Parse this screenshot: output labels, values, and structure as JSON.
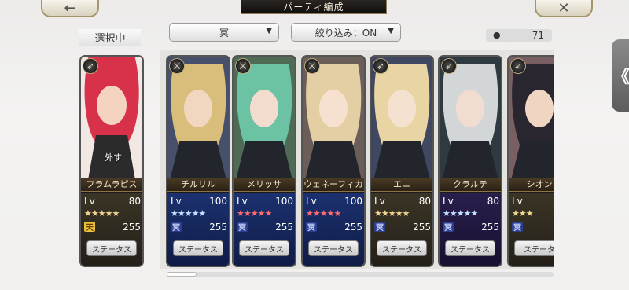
{
  "header": {
    "back_label": "←",
    "close_label": "✕",
    "title": "パーティ編成"
  },
  "selected_label": "選択中",
  "filters": {
    "sort_value": "冥",
    "filter_value": "絞り込み：ON"
  },
  "owned_count": "71",
  "side_tab_label": "《",
  "selected_card": {
    "name": "フラムラピス",
    "lv_label": "Lv",
    "level": "80",
    "stars": "★★★★★",
    "element_icon": "天",
    "element_value": "255",
    "remove_label": "外す",
    "status_label": "ステータス",
    "class_icon": "bow-icon",
    "colors": {
      "hair": "#d8324a",
      "skin": "#f4d3c0",
      "bg": "#f1e7e3"
    }
  },
  "cards": [
    {
      "name": "チルリル",
      "lv_label": "Lv",
      "level": "100",
      "stars": "★★★★★",
      "star_color": "blue",
      "element_icon": "冥",
      "element_value": "255",
      "status_label": "ステータス",
      "class_icon": "sword-icon",
      "theme": "blue",
      "colors": {
        "hair": "#d9bd7a",
        "skin": "#f2d7c0",
        "bg": "#46506a"
      }
    },
    {
      "name": "メリッサ",
      "lv_label": "Lv",
      "level": "100",
      "stars": "★★★★★",
      "star_color": "red",
      "element_icon": "冥",
      "element_value": "255",
      "status_label": "ステータス",
      "class_icon": "sword-icon",
      "theme": "blue",
      "colors": {
        "hair": "#6cc3a4",
        "skin": "#f3dccd",
        "bg": "#4f6a55"
      }
    },
    {
      "name": "ウェネーフィカ",
      "lv_label": "Lv",
      "level": "100",
      "stars": "★★★★★",
      "star_color": "red",
      "element_icon": "冥",
      "element_value": "255",
      "status_label": "ステータス",
      "class_icon": "sword-icon",
      "theme": "blue",
      "colors": {
        "hair": "#e4cfa5",
        "skin": "#f6e0cf",
        "bg": "#6b5e58"
      }
    },
    {
      "name": "エニ",
      "lv_label": "Lv",
      "level": "80",
      "stars": "★★★★★",
      "star_color": "gold",
      "element_icon": "冥",
      "element_value": "255",
      "status_label": "ステータス",
      "class_icon": "bow-icon",
      "theme": "gold",
      "colors": {
        "hair": "#e9d5a4",
        "skin": "#f5e1d0",
        "bg": "#3f4761"
      }
    },
    {
      "name": "クラルテ",
      "lv_label": "Lv",
      "level": "80",
      "stars": "★★★★★",
      "star_color": "blue",
      "element_icon": "冥",
      "element_value": "255",
      "status_label": "ステータス",
      "class_icon": "bow-icon",
      "theme": "purple",
      "colors": {
        "hair": "#d3d6d6",
        "skin": "#f1ddcf",
        "bg": "#2e3a3f"
      }
    },
    {
      "name": "シオン",
      "lv_label": "Lv",
      "level": "8",
      "stars": "★★★",
      "star_color": "gold",
      "element_icon": "冥",
      "element_value": "2",
      "status_label": "ステータ",
      "class_icon": "bow-icon",
      "theme": "gold",
      "colors": {
        "hair": "#2a2630",
        "skin": "#f0d6c2",
        "bg": "#7a5f62"
      }
    }
  ]
}
